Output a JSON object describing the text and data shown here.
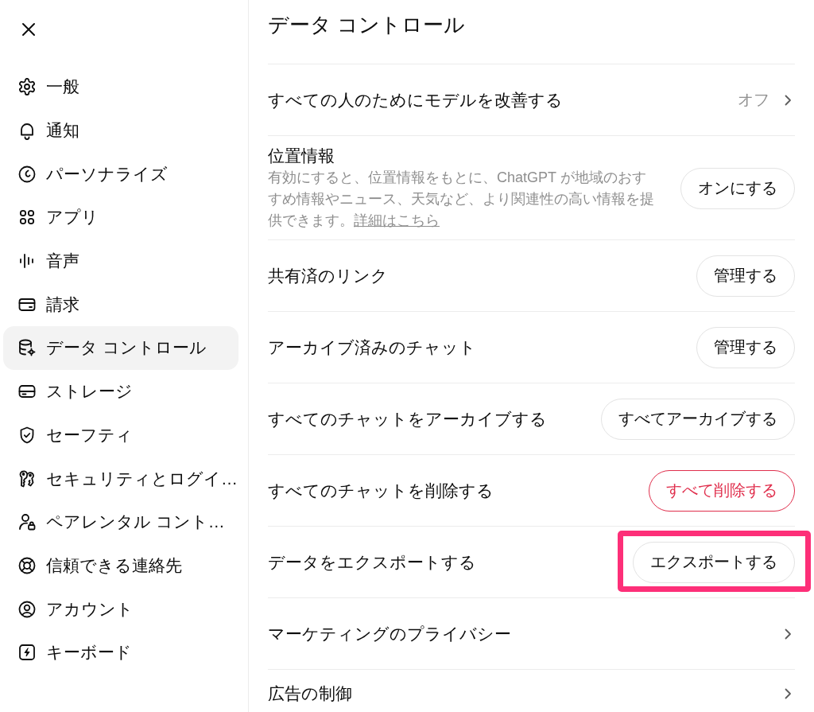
{
  "sidebar": {
    "items": [
      {
        "label": "一般",
        "selected": false
      },
      {
        "label": "通知",
        "selected": false
      },
      {
        "label": "パーソナライズ",
        "selected": false
      },
      {
        "label": "アプリ",
        "selected": false
      },
      {
        "label": "音声",
        "selected": false
      },
      {
        "label": "請求",
        "selected": false
      },
      {
        "label": "データ コントロール",
        "selected": true
      },
      {
        "label": "ストレージ",
        "selected": false
      },
      {
        "label": "セーフティ",
        "selected": false
      },
      {
        "label": "セキュリティとログイ…",
        "selected": false
      },
      {
        "label": "ペアレンタル コント…",
        "selected": false
      },
      {
        "label": "信頼できる連絡先",
        "selected": false
      },
      {
        "label": "アカウント",
        "selected": false
      },
      {
        "label": "キーボード",
        "selected": false
      }
    ]
  },
  "content": {
    "title": "データ コントロール",
    "settings": [
      {
        "kind": "value",
        "label": "すべての人のためにモデルを改善する",
        "value": "オフ",
        "highlighted": false
      },
      {
        "kind": "button",
        "label": "位置情報",
        "description": "有効にすると、位置情報をもとに、ChatGPT が地域のおすすめ情報やニュース、天気など、より関連性の高い情報を提供できます。",
        "link": "詳細はこちら",
        "button": "オンにする",
        "danger": false,
        "highlighted": false
      },
      {
        "kind": "button",
        "label": "共有済のリンク",
        "button": "管理する",
        "danger": false,
        "highlighted": false
      },
      {
        "kind": "button",
        "label": "アーカイブ済みのチャット",
        "button": "管理する",
        "danger": false,
        "highlighted": false
      },
      {
        "kind": "button",
        "label": "すべてのチャットをアーカイブする",
        "button": "すべてアーカイブする",
        "danger": false,
        "highlighted": false
      },
      {
        "kind": "button",
        "label": "すべてのチャットを削除する",
        "button": "すべて削除する",
        "danger": true,
        "highlighted": false
      },
      {
        "kind": "button",
        "label": "データをエクスポートする",
        "button": "エクスポートする",
        "danger": false,
        "highlighted": true
      },
      {
        "kind": "link",
        "label": "マーケティングのプライバシー",
        "highlighted": false
      },
      {
        "kind": "link",
        "label": "広告の制御",
        "highlighted": false
      }
    ]
  }
}
